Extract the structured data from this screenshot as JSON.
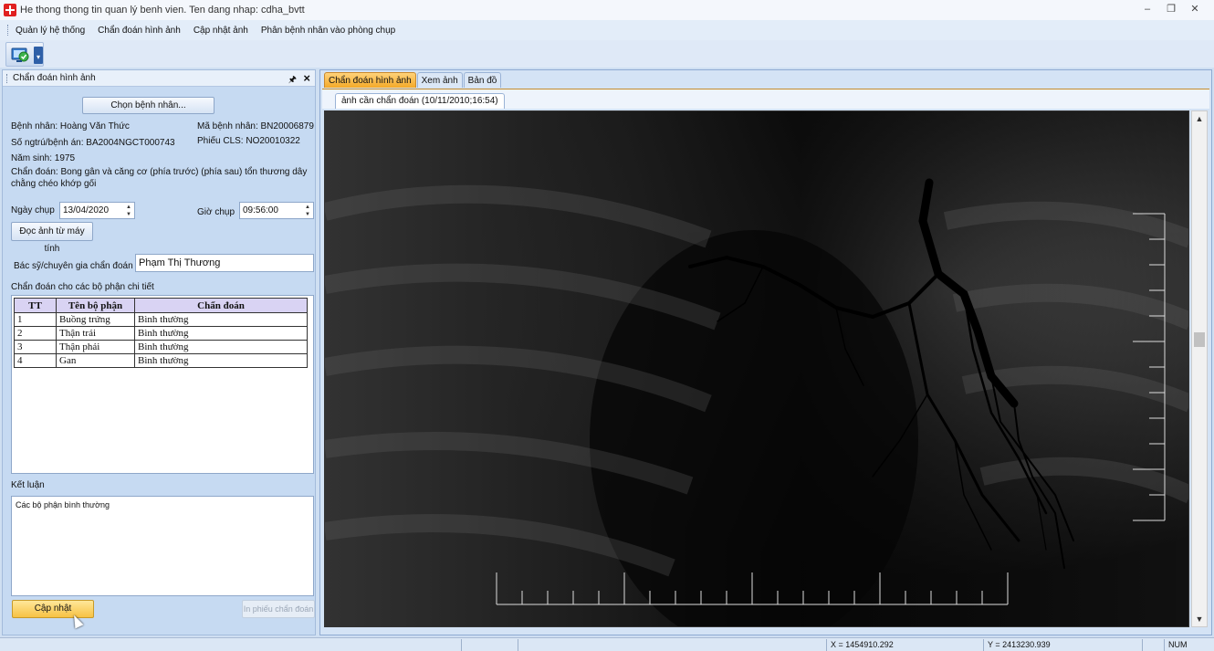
{
  "window": {
    "title": "He thong thong tin quan lý benh vien. Ten dang nhap: cdha_bvtt",
    "minimize": "–",
    "restore": "❐",
    "close": "✕"
  },
  "menu": {
    "items": [
      "Quản lý hệ thống",
      "Chẩn đoán hình ảnh",
      "Cập nhật ảnh",
      "Phân bệnh nhân vào phòng chụp"
    ]
  },
  "left_panel": {
    "header": "Chẩn đoán hình ảnh",
    "pin": "🖈",
    "close": "×",
    "choose_patient_button": "Chọn bệnh nhân...",
    "patient_name": "Bệnh nhân: Hoàng Văn Thức",
    "patient_id": "Mã bệnh nhân: BN20006879",
    "record_no": "Số ngtrú/bệnh án: BA2004NGCT000743",
    "cls_slip": "Phiếu CLS: NO20010322",
    "birth_year": "Năm sinh: 1975",
    "diagnosis": "Chẩn đoán: Bong gân và căng cơ (phía trước) (phía sau) tổn thương dây chằng chéo khớp gối",
    "date_label": "Ngày chụp",
    "date_value": "13/04/2020",
    "time_label": "Giờ chụp",
    "time_value": "09:56:00",
    "read_image_button": "Đọc ảnh từ máy tính",
    "doctor_label": "Bác sỹ/chuyên gia chẩn đoán",
    "doctor_value": "Phạm Thị Thương",
    "detail_title": "Chẩn đoán cho các bộ phận chi tiết",
    "table": {
      "headers": [
        "TT",
        "Tên bộ phận",
        "Chẩn đoán"
      ],
      "rows": [
        [
          "1",
          "Buồng trứng",
          "Bình thường"
        ],
        [
          "2",
          "Thận trái",
          "Bình thường"
        ],
        [
          "3",
          "Thận phải",
          "Bình thường"
        ],
        [
          "4",
          "Gan",
          "Bình thường"
        ]
      ]
    },
    "conclusion_label": "Kết luận",
    "conclusion_value": "Các bộ phận bình thường",
    "update_button": "Cập nhật",
    "print_button": "In phiếu chẩn đoán"
  },
  "right_panel": {
    "tabs": [
      "Chẩn đoán hình ảnh",
      "Xem ảnh",
      "Bản đồ"
    ],
    "active_tab": 0,
    "subtab": "ảnh cần chẩn đoán (10/11/2010;16:54)",
    "scroll_up": "▲",
    "scroll_down": "▼"
  },
  "status": {
    "x": "X = 1454910.292",
    "y": "Y = 2413230.939",
    "num": "NUM"
  },
  "colors": {
    "active_tab": "#f4a928",
    "update_button": "#f7c244",
    "table_header": "#d9d3f3",
    "panel_bg": "#c6daf2"
  }
}
